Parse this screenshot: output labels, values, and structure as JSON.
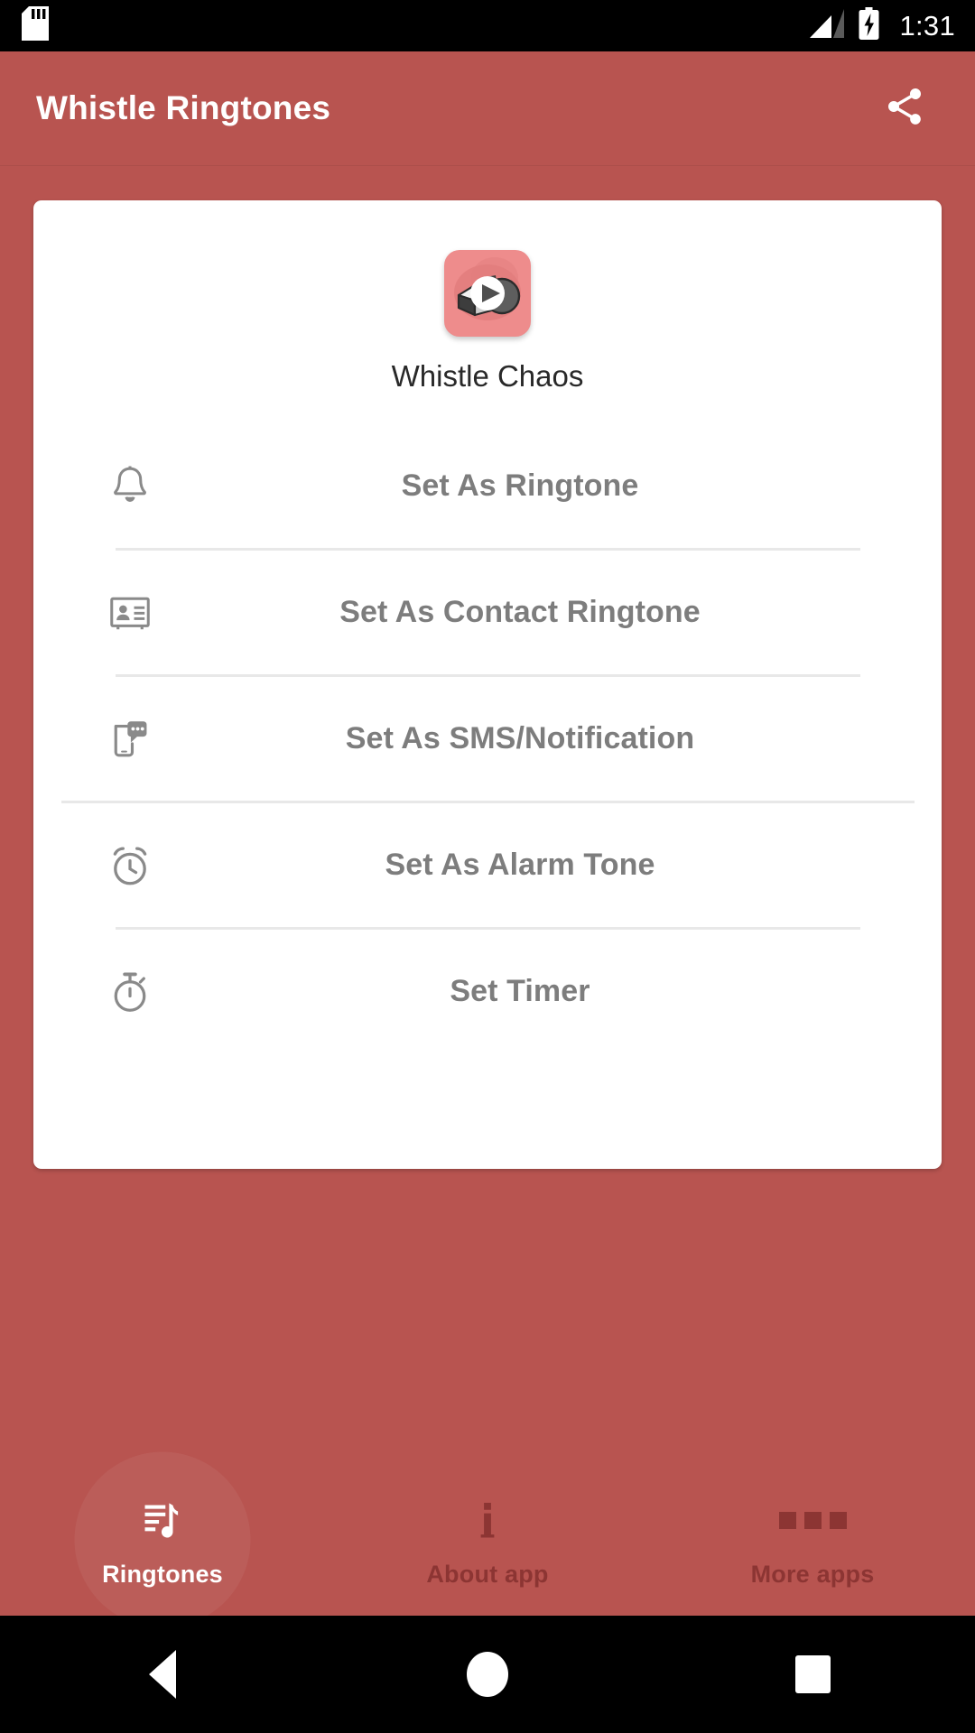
{
  "status_bar": {
    "time": "1:31",
    "icons": [
      "sd-card-icon",
      "signal-icon",
      "battery-charging-icon"
    ]
  },
  "app_bar": {
    "title": "Whistle Ringtones",
    "share_icon": "share-icon"
  },
  "card": {
    "album_art_icon": "whistle-play-icon",
    "track_title": "Whistle Chaos",
    "actions": [
      {
        "icon": "bell-icon",
        "label": "Set As Ringtone",
        "divider_after": "narrow"
      },
      {
        "icon": "contact-card-icon",
        "label": "Set As Contact Ringtone",
        "divider_after": "narrow"
      },
      {
        "icon": "sms-bubble-icon",
        "label": "Set As SMS/Notification",
        "divider_after": "wide"
      },
      {
        "icon": "alarm-clock-icon",
        "label": "Set As Alarm Tone",
        "divider_after": "narrow"
      },
      {
        "icon": "stopwatch-icon",
        "label": "Set Timer",
        "divider_after": "none"
      }
    ]
  },
  "bottom_nav": {
    "items": [
      {
        "icon": "playlist-music-icon",
        "label": "Ringtones",
        "active": true
      },
      {
        "icon": "info-icon",
        "label": "About app",
        "active": false
      },
      {
        "icon": "more-dots-icon",
        "label": "More apps",
        "active": false
      }
    ]
  },
  "android_nav": {
    "back": "back-triangle-icon",
    "home": "home-circle-icon",
    "recents": "recents-square-icon"
  },
  "colors": {
    "primary": "#B85450",
    "nav_inactive": "#8C3533",
    "card_bg": "#FFFFFF",
    "label_gray": "#7D7D7D",
    "album_pink": "#EE8C8C"
  }
}
